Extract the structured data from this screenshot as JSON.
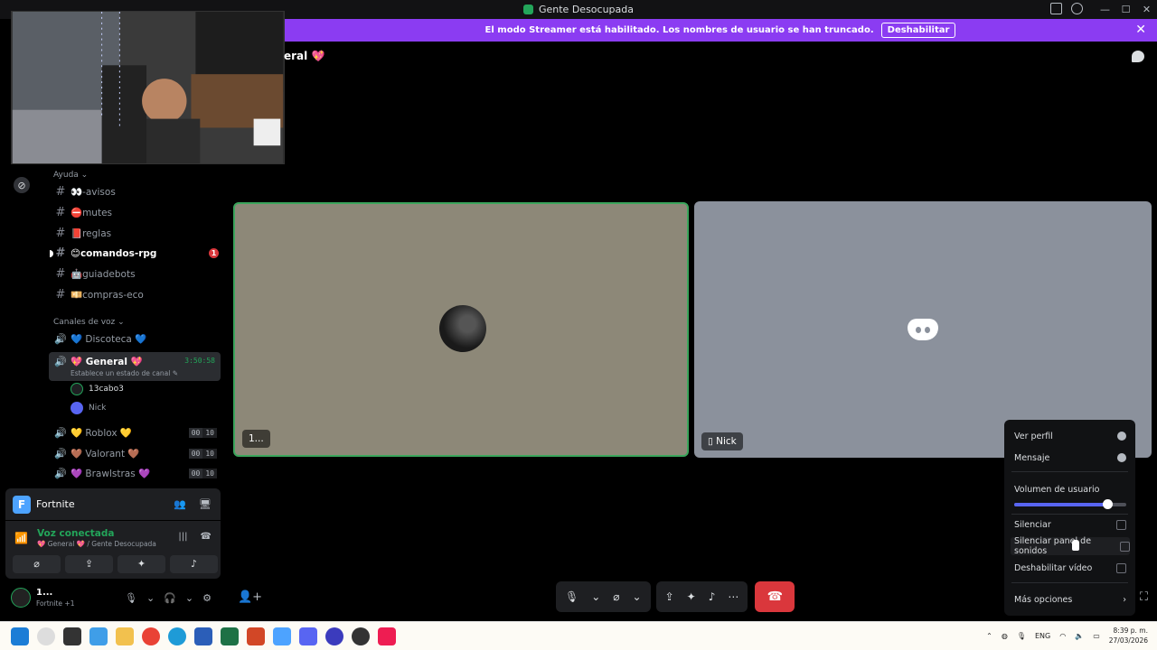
{
  "window": {
    "title": "Gente Desocupada",
    "controls": [
      "—",
      "☐",
      "✕"
    ]
  },
  "banner": {
    "text": "El modo Streamer está habilitado. Los nombres de usuario se han truncado.",
    "button": "Deshabilitar",
    "close": "✕"
  },
  "header": {
    "channel": "eral 💖"
  },
  "sidebar": {
    "help_category": "Ayuda ⌄",
    "text_channels": [
      {
        "name": "👀-avisos",
        "unread": false,
        "badge": ""
      },
      {
        "name": "⛔mutes",
        "unread": false,
        "badge": ""
      },
      {
        "name": "📕reglas",
        "unread": false,
        "badge": ""
      },
      {
        "name": "😊comandos-rpg",
        "unread": true,
        "badge": "1"
      },
      {
        "name": "🤖guiadebots",
        "unread": false,
        "badge": ""
      },
      {
        "name": "💴compras-eco",
        "unread": false,
        "badge": ""
      }
    ],
    "voice_category": "Canales de voz ⌄",
    "voice_channels": [
      {
        "name": "💙 Discoteca 💙",
        "count": "",
        "limit": ""
      },
      {
        "name": "💛 Roblox 💛",
        "count": "00",
        "limit": "10"
      },
      {
        "name": "🤎 Valorant 🤎",
        "count": "00",
        "limit": "10"
      },
      {
        "name": "💜 Brawlstras 💜",
        "count": "00",
        "limit": "10"
      }
    ],
    "active_channel": {
      "name": "💖 General 💖",
      "timer": "3:50:58",
      "status": "Establece un estado de canal ✎"
    },
    "voice_users": [
      {
        "name": "13cabo3"
      },
      {
        "name": "Nick"
      }
    ]
  },
  "activity": {
    "game": "Fortnite",
    "icon_letter": "F"
  },
  "voice_panel": {
    "title": "Voz conectada",
    "subtitle": "💖 General 💖 / Gente Desocupada"
  },
  "user": {
    "name": "1...",
    "status": "Fortnite +1"
  },
  "tiles": [
    {
      "label": "1..."
    },
    {
      "label": "▯ Nick"
    }
  ],
  "context_menu": {
    "view_profile": "Ver perfil",
    "message": "Mensaje",
    "user_volume": "Volumen de usuario",
    "volume_fraction": 0.83,
    "mute": "Silenciar",
    "mute_soundboard": "Silenciar panel de sonidos",
    "disable_video": "Deshabilitar vídeo",
    "more_options": "Más opciones"
  },
  "taskbar": {
    "language": "ENG",
    "time": "8:39 p. m.",
    "date": "27/03/2026"
  }
}
